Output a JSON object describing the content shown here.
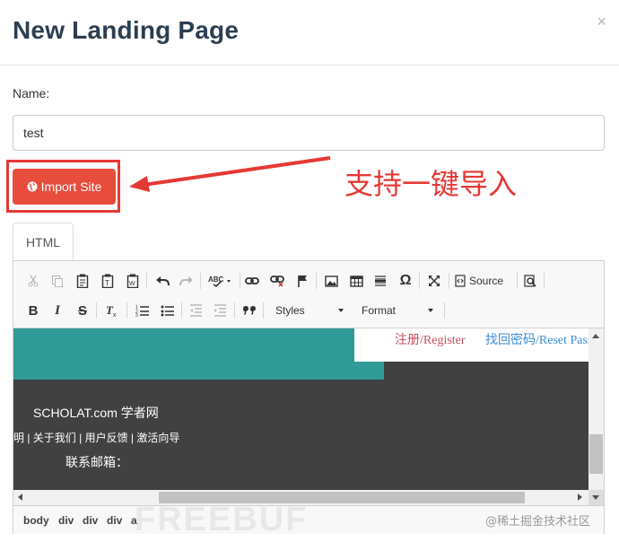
{
  "modal": {
    "title": "New Landing Page",
    "close_glyph": "×"
  },
  "form": {
    "name_label": "Name:",
    "name_value": "test",
    "import_button_label": "Import Site",
    "import_icon": "globe-icon"
  },
  "annotation": {
    "text": "支持一键导入",
    "color": "#e53935"
  },
  "tabs": [
    {
      "label": "HTML",
      "active": true
    }
  ],
  "toolbar": {
    "row1": [
      {
        "name": "cut-icon",
        "glyph": "✂",
        "enabled": false
      },
      {
        "name": "copy-icon",
        "glyph": "⎘",
        "enabled": false
      },
      {
        "name": "paste-icon",
        "glyph": "📋",
        "enabled": true
      },
      {
        "name": "paste-text-icon",
        "glyph": "📋",
        "enabled": true
      },
      {
        "name": "paste-word-icon",
        "glyph": "📋",
        "enabled": true
      },
      {
        "name": "undo-icon",
        "glyph": "↶",
        "enabled": true
      },
      {
        "name": "redo-icon",
        "glyph": "↷",
        "enabled": false
      },
      {
        "name": "spellcheck-icon",
        "glyph": "ABC✓",
        "enabled": true
      },
      {
        "name": "link-icon",
        "glyph": "🔗",
        "enabled": true
      },
      {
        "name": "unlink-icon",
        "glyph": "⛓",
        "enabled": true
      },
      {
        "name": "anchor-flag-icon",
        "glyph": "⚑",
        "enabled": true
      },
      {
        "name": "image-icon",
        "glyph": "🖼",
        "enabled": true
      },
      {
        "name": "table-icon",
        "glyph": "▦",
        "enabled": true
      },
      {
        "name": "horizontal-line-icon",
        "glyph": "≡",
        "enabled": true
      },
      {
        "name": "special-char-icon",
        "glyph": "Ω",
        "enabled": true
      },
      {
        "name": "maximize-icon",
        "glyph": "⤢",
        "enabled": true
      },
      {
        "name": "source-icon",
        "label": "Source",
        "enabled": true
      },
      {
        "name": "preview-icon",
        "glyph": "🔍",
        "enabled": true
      }
    ],
    "row2": [
      {
        "name": "bold-icon",
        "glyph": "B"
      },
      {
        "name": "italic-icon",
        "glyph": "I"
      },
      {
        "name": "strike-icon",
        "glyph": "S"
      },
      {
        "name": "remove-format-icon",
        "glyph": "Tx"
      },
      {
        "name": "numbered-list-icon",
        "glyph": "1≡"
      },
      {
        "name": "bulleted-list-icon",
        "glyph": "•≡"
      },
      {
        "name": "outdent-icon",
        "glyph": "⇤"
      },
      {
        "name": "indent-icon",
        "glyph": "⇥"
      },
      {
        "name": "blockquote-icon",
        "glyph": "❞"
      }
    ],
    "styles_label": "Styles",
    "format_label": "Format"
  },
  "content": {
    "register_text": "注册/Register",
    "reset_text": "找回密码/Reset Pass",
    "site_title": "SCHOLAT.com 学者网",
    "footer_links": "声明 | 关于我们 | 用户反馈 | 激活向导",
    "contact_label": "联系邮箱：",
    "teal_color": "#2f9a96",
    "dark_color": "#414141"
  },
  "statusbar": {
    "path": [
      "body",
      "div",
      "div",
      "div",
      "a"
    ]
  },
  "watermark": {
    "text": "@稀土掘金技术社区",
    "bg_text": "FREEBUF"
  }
}
